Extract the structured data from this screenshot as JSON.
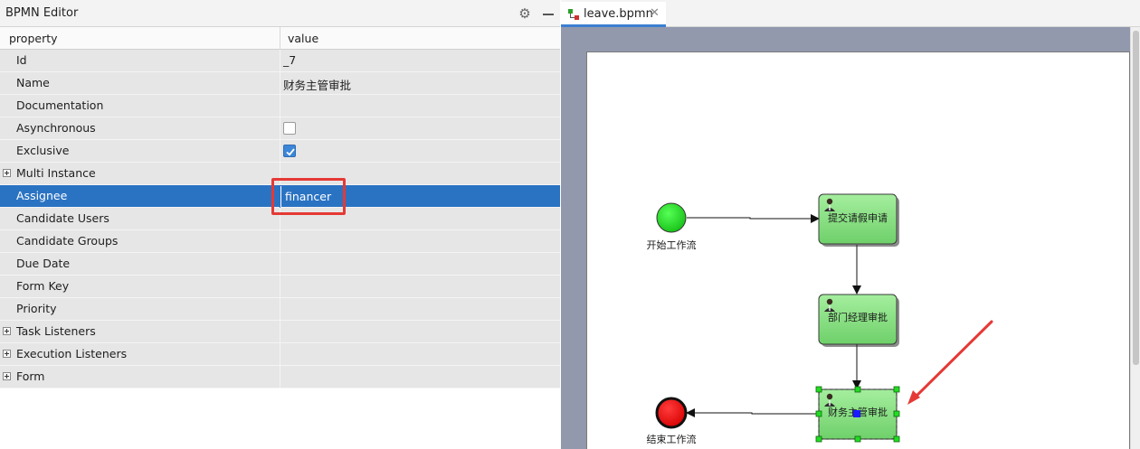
{
  "properties_panel": {
    "title": "BPMN Editor",
    "header": {
      "property": "property",
      "value": "value"
    },
    "rows": [
      {
        "name": "Id",
        "value": "_7"
      },
      {
        "name": "Name",
        "value": "财务主管审批"
      },
      {
        "name": "Documentation",
        "value": ""
      },
      {
        "name": "Asynchronous",
        "checked": false
      },
      {
        "name": "Exclusive",
        "checked": true
      },
      {
        "name": "Multi Instance",
        "value": ""
      },
      {
        "name": "Assignee",
        "value": "financer"
      },
      {
        "name": "Candidate Users",
        "value": ""
      },
      {
        "name": "Candidate Groups",
        "value": ""
      },
      {
        "name": "Due Date",
        "value": ""
      },
      {
        "name": "Form Key",
        "value": ""
      },
      {
        "name": "Priority",
        "value": ""
      },
      {
        "name": "Task Listeners",
        "value": ""
      },
      {
        "name": "Execution Listeners",
        "value": ""
      },
      {
        "name": "Form",
        "value": ""
      }
    ],
    "selected_row": "Assignee"
  },
  "editor": {
    "tab_label": "leave.bpmn",
    "diagram": {
      "start_event_label": "开始工作流",
      "end_event_label": "结束工作流",
      "tasks": [
        "提交请假申请",
        "部门经理审批",
        "财务主管审批"
      ],
      "selected_task": "财务主管审批"
    }
  },
  "colors": {
    "selection": "#2a73c3",
    "highlight": "#e53935",
    "start_event": "#22cc22",
    "end_event": "#e60000",
    "task_fill": "#86e086",
    "canvas_bg": "#9299ad"
  }
}
